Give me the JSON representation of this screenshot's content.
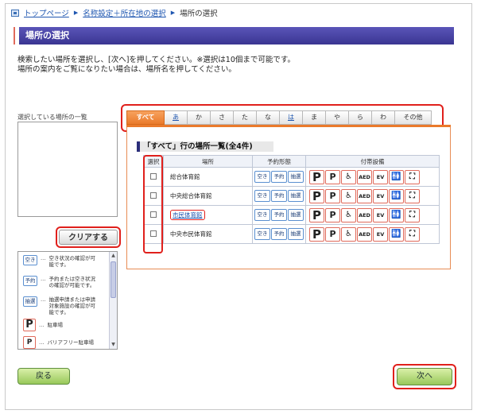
{
  "breadcrumb": {
    "home": "トップページ",
    "step2": "名称設定＋所在地の選択",
    "current": "場所の選択"
  },
  "header": {
    "title": "場所の選択"
  },
  "instructions": {
    "line1": "検索したい場所を選択し、[次へ]を押してください。※選択は10個まで可能です。",
    "line2": "場所の案内をご覧になりたい場合は、場所名を押してください。"
  },
  "left": {
    "selected_label": "選択している場所の一覧",
    "clear_button": "クリアする"
  },
  "legend": [
    {
      "badge": "空き",
      "dots": "…",
      "text": "空き状況の確認が可能です。"
    },
    {
      "badge": "予約",
      "dots": "…",
      "text": "予約または空き状況の確認が可能です。"
    },
    {
      "badge": "抽選",
      "dots": "…",
      "text": "抽選申請または申請対象施設の確認が可能です。"
    },
    {
      "badge": "P",
      "dots": "…",
      "text": "駐車場"
    },
    {
      "badge": "P♿",
      "dots": "…",
      "text": "バリアフリー駐車場"
    }
  ],
  "tabs": [
    "すべて",
    "あ",
    "か",
    "さ",
    "た",
    "な",
    "は",
    "ま",
    "や",
    "ら",
    "わ",
    "その他"
  ],
  "list_title": "「すべて」行の場所一覧(全4件)",
  "table": {
    "headers": {
      "select": "選択",
      "place": "場所",
      "reservation": "予約形態",
      "facilities": "付帯設備"
    },
    "reservation_labels": [
      "空き",
      "予約",
      "抽選"
    ],
    "facility_labels": [
      "P",
      "P♿",
      "♿",
      "AED",
      "EV",
      "🚻",
      "⛶"
    ],
    "rows": [
      {
        "name": "総合体育館",
        "link": false
      },
      {
        "name": "中央総合体育館",
        "link": false
      },
      {
        "name": "市民体育館",
        "link": true
      },
      {
        "name": "中央市民体育館",
        "link": false
      }
    ]
  },
  "buttons": {
    "back": "戻る",
    "next": "次へ"
  },
  "colors": {
    "accent": "#ea7a2b",
    "header": "#3a3592",
    "highlight": "#e0201c",
    "button_green": "#98c85a"
  }
}
